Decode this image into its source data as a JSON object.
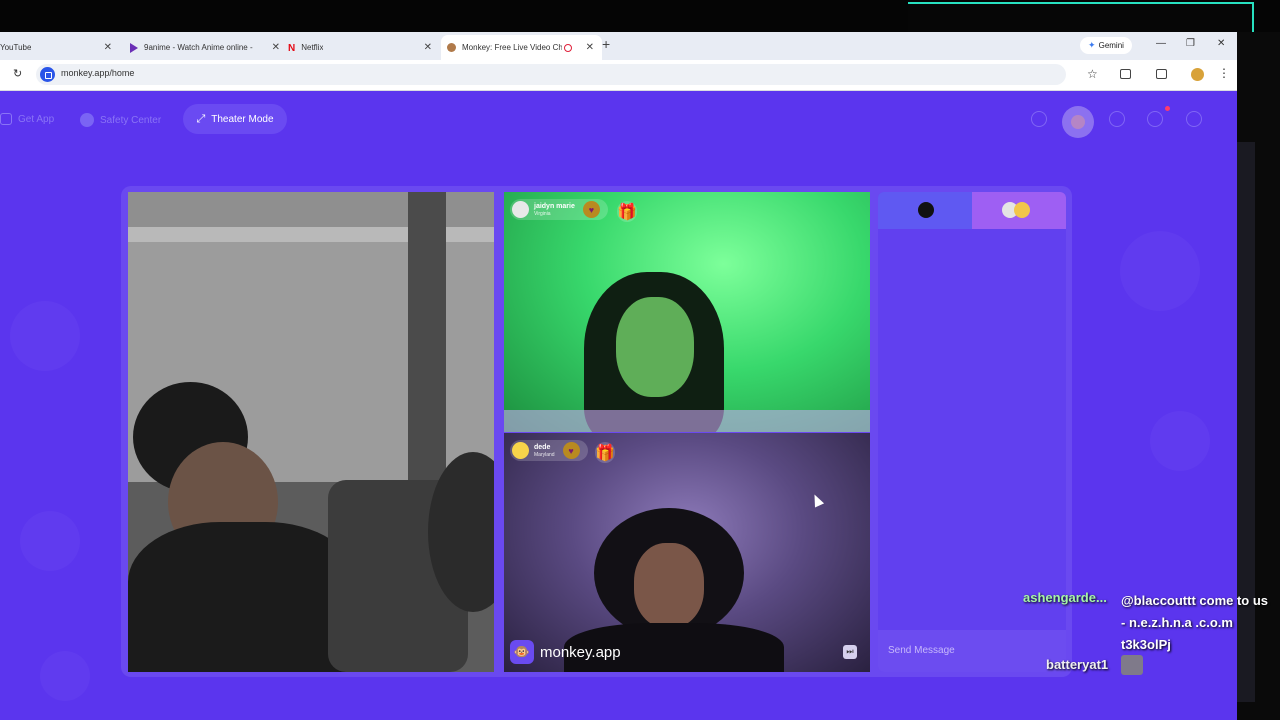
{
  "browser": {
    "tabs": [
      {
        "label": "YouTube",
        "icon": "youtube-icon"
      },
      {
        "label": "9anime - Watch Anime online -",
        "icon": "play-icon"
      },
      {
        "label": "Netflix",
        "icon": "netflix-icon"
      },
      {
        "label": "Monkey: Free Live Video Ch",
        "icon": "monkey-icon",
        "active": true
      }
    ],
    "new_tab": "+",
    "gemini_label": "Gemini",
    "url": "monkey.app/home"
  },
  "nav": {
    "get_app": "Get App",
    "safety_center": "Safety Center",
    "theater_mode": "Theater Mode"
  },
  "videos": {
    "top_right": {
      "name": "jaidyn marie",
      "location": "Virginia"
    },
    "bottom_right": {
      "name": "dede",
      "location": "Maryland"
    }
  },
  "brand": {
    "name": "monkey.app"
  },
  "chat": {
    "send_placeholder": "Send Message"
  },
  "stream_overlay": {
    "user1": "ashengarde...",
    "message1": "@blaccouttt come to us - n.e.z.h.n.a .c.o.m t3k3olPj",
    "user2": "batteryat1"
  },
  "colors": {
    "page_bg": "#5b35ee",
    "accent": "#6a4af2",
    "overlay_user1": "#a6f5a6"
  }
}
